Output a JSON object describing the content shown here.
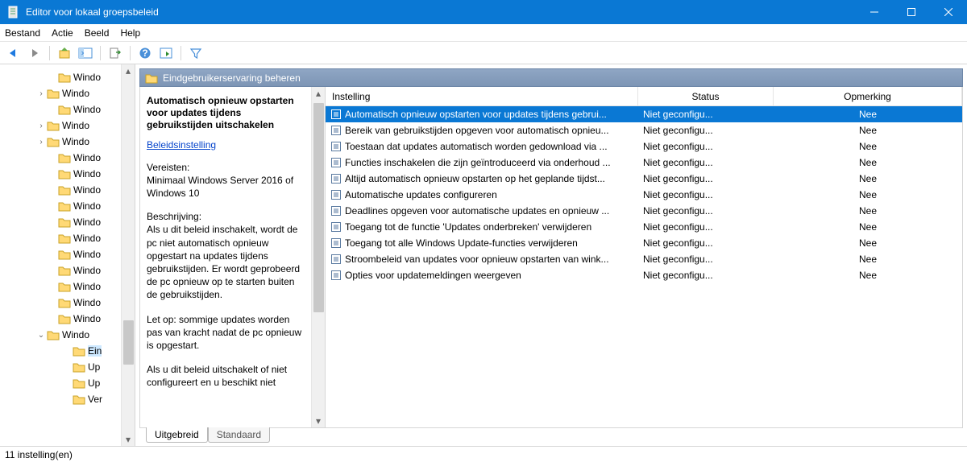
{
  "window": {
    "title": "Editor voor lokaal groepsbeleid"
  },
  "menubar": {
    "bestand": "Bestand",
    "actie": "Actie",
    "beeld": "Beeld",
    "help": "Help"
  },
  "tree": {
    "items": [
      {
        "indent": 72,
        "exp": "",
        "label": "Windo"
      },
      {
        "indent": 58,
        "exp": ">",
        "label": "Windo"
      },
      {
        "indent": 72,
        "exp": "",
        "label": "Windo"
      },
      {
        "indent": 58,
        "exp": ">",
        "label": "Windo"
      },
      {
        "indent": 58,
        "exp": ">",
        "label": "Windo"
      },
      {
        "indent": 72,
        "exp": "",
        "label": "Windo"
      },
      {
        "indent": 72,
        "exp": "",
        "label": "Windo"
      },
      {
        "indent": 72,
        "exp": "",
        "label": "Windo"
      },
      {
        "indent": 72,
        "exp": "",
        "label": "Windo"
      },
      {
        "indent": 72,
        "exp": "",
        "label": "Windo"
      },
      {
        "indent": 72,
        "exp": "",
        "label": "Windo"
      },
      {
        "indent": 72,
        "exp": "",
        "label": "Windo"
      },
      {
        "indent": 72,
        "exp": "",
        "label": "Windo"
      },
      {
        "indent": 72,
        "exp": "",
        "label": "Windo"
      },
      {
        "indent": 72,
        "exp": "",
        "label": "Windo"
      },
      {
        "indent": 72,
        "exp": "",
        "label": "Windo"
      },
      {
        "indent": 58,
        "exp": "v",
        "label": "Windo"
      },
      {
        "indent": 90,
        "exp": "",
        "label": "Ein",
        "selected": true
      },
      {
        "indent": 90,
        "exp": "",
        "label": "Up"
      },
      {
        "indent": 90,
        "exp": "",
        "label": "Up"
      },
      {
        "indent": 90,
        "exp": "",
        "label": "Ver"
      }
    ]
  },
  "category": {
    "title": "Eindgebruikerservaring beheren"
  },
  "detail": {
    "policy_name": "Automatisch opnieuw opstarten voor updates tijdens gebruikstijden uitschakelen",
    "policy_link": "Beleidsinstelling",
    "req_label": "Vereisten:",
    "requirements": "Minimaal Windows Server 2016 of Windows 10",
    "desc_label": "Beschrijving:",
    "description_p1": "Als u dit beleid inschakelt, wordt de pc niet automatisch opnieuw opgestart na updates tijdens gebruikstijden. Er wordt geprobeerd de pc opnieuw op te starten buiten de gebruikstijden.",
    "description_p2": "Let op: sommige updates worden pas van kracht nadat de pc opnieuw is opgestart.",
    "description_p3": "Als u dit beleid uitschakelt of niet configureert en u beschikt niet"
  },
  "columns": {
    "setting": "Instelling",
    "status": "Status",
    "comment": "Opmerking"
  },
  "rows": [
    {
      "setting": "Automatisch opnieuw opstarten voor updates tijdens gebrui...",
      "status": "Niet geconfigu...",
      "comment": "Nee",
      "selected": true
    },
    {
      "setting": "Bereik van gebruikstijden opgeven voor automatisch opnieu...",
      "status": "Niet geconfigu...",
      "comment": "Nee"
    },
    {
      "setting": "Toestaan dat updates automatisch worden gedownload via ...",
      "status": "Niet geconfigu...",
      "comment": "Nee"
    },
    {
      "setting": "Functies inschakelen die zijn geïntroduceerd via onderhoud ...",
      "status": "Niet geconfigu...",
      "comment": "Nee"
    },
    {
      "setting": "Altijd automatisch opnieuw opstarten op het geplande tijdst...",
      "status": "Niet geconfigu...",
      "comment": "Nee"
    },
    {
      "setting": "Automatische updates configureren",
      "status": "Niet geconfigu...",
      "comment": "Nee"
    },
    {
      "setting": "Deadlines opgeven voor automatische updates en opnieuw ...",
      "status": "Niet geconfigu...",
      "comment": "Nee"
    },
    {
      "setting": "Toegang tot de functie 'Updates onderbreken' verwijderen",
      "status": "Niet geconfigu...",
      "comment": "Nee"
    },
    {
      "setting": "Toegang tot alle Windows Update-functies verwijderen",
      "status": "Niet geconfigu...",
      "comment": "Nee"
    },
    {
      "setting": "Stroombeleid van updates voor opnieuw opstarten van wink...",
      "status": "Niet geconfigu...",
      "comment": "Nee"
    },
    {
      "setting": "Opties voor updatemeldingen weergeven",
      "status": "Niet geconfigu...",
      "comment": "Nee"
    }
  ],
  "tabs": {
    "uitgebreid": "Uitgebreid",
    "standaard": "Standaard"
  },
  "statusbar": {
    "text": "11 instelling(en)"
  }
}
